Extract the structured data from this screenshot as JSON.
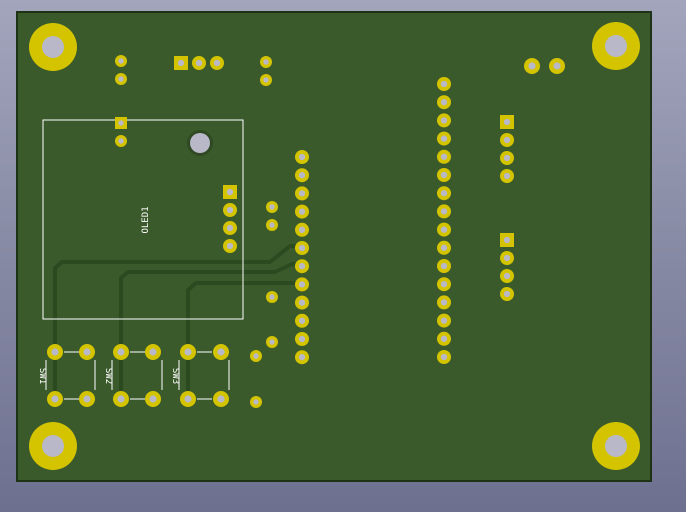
{
  "board": {
    "substrate_color": "#2f4a22",
    "mask_color": "#3b5a2c",
    "edge_color": "#1e3216",
    "copper_color": "#d4c400",
    "copper_dark": "#9f9200",
    "drill_color": "#b8b8c8",
    "silk_color": "#ffffff",
    "trace_color": "#2c4a20"
  },
  "labels": {
    "oled": "OLED1",
    "sw1": "SW1",
    "sw2": "SW2",
    "sw3": "SW3"
  },
  "icons": {
    "mounting_hole": "mounting-hole-icon",
    "pad": "pad-icon",
    "square_pad": "square-pad-icon"
  }
}
